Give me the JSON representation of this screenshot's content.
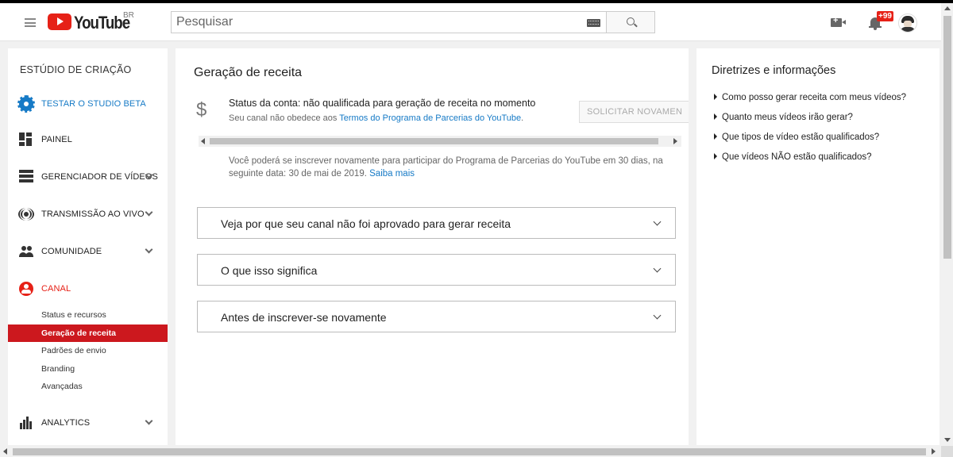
{
  "header": {
    "logo_text": "YouTube",
    "region": "BR",
    "search_placeholder": "Pesquisar",
    "notification_count": "+99"
  },
  "sidebar": {
    "title": "ESTÚDIO DE CRIAÇÃO",
    "studio_beta": "TESTAR O STUDIO BETA",
    "items": [
      {
        "label": "PAINEL",
        "icon": "dashboard-icon"
      },
      {
        "label": "GERENCIADOR DE VÍDEOS",
        "icon": "videos-icon"
      },
      {
        "label": "TRANSMISSÃO AO VIVO",
        "icon": "live-icon"
      },
      {
        "label": "COMUNIDADE",
        "icon": "community-icon"
      },
      {
        "label": "CANAL",
        "icon": "channel-icon"
      },
      {
        "label": "ANALYTICS",
        "icon": "analytics-icon"
      }
    ],
    "channel_sub": [
      "Status e recursos",
      "Geração de receita",
      "Padrões de envio",
      "Branding",
      "Avançadas"
    ],
    "active_sub": "Geração de receita"
  },
  "main": {
    "title": "Geração de receita",
    "status_title": "Status da conta: não qualificada para geração de receita no momento",
    "status_sub_prefix": "Seu canal não obedece aos ",
    "status_sub_link": "Termos do Programa de Parcerias do YouTube",
    "status_sub_suffix": ".",
    "reapply_button": "SOLICITAR NOVAMEN",
    "reapply_text": "Você poderá se inscrever novamente para participar do Programa de Parcerias do YouTube em 30 dias, na seguinte data: 30 de mai de 2019.",
    "reapply_link": "Saiba mais",
    "accordions": [
      "Veja por que seu canal não foi aprovado para gerar receita",
      "O que isso significa",
      "Antes de inscrever-se novamente"
    ]
  },
  "right_panel": {
    "title": "Diretrizes e informações",
    "links": [
      "Como posso gerar receita com meus vídeos?",
      "Quanto meus vídeos irão gerar?",
      "Que tipos de vídeo estão qualificados?",
      "Que vídeos NÃO estão qualificados?"
    ]
  },
  "colors": {
    "brand_red": "#e62117",
    "active_red": "#cc181e",
    "link_blue": "#167ac6"
  }
}
